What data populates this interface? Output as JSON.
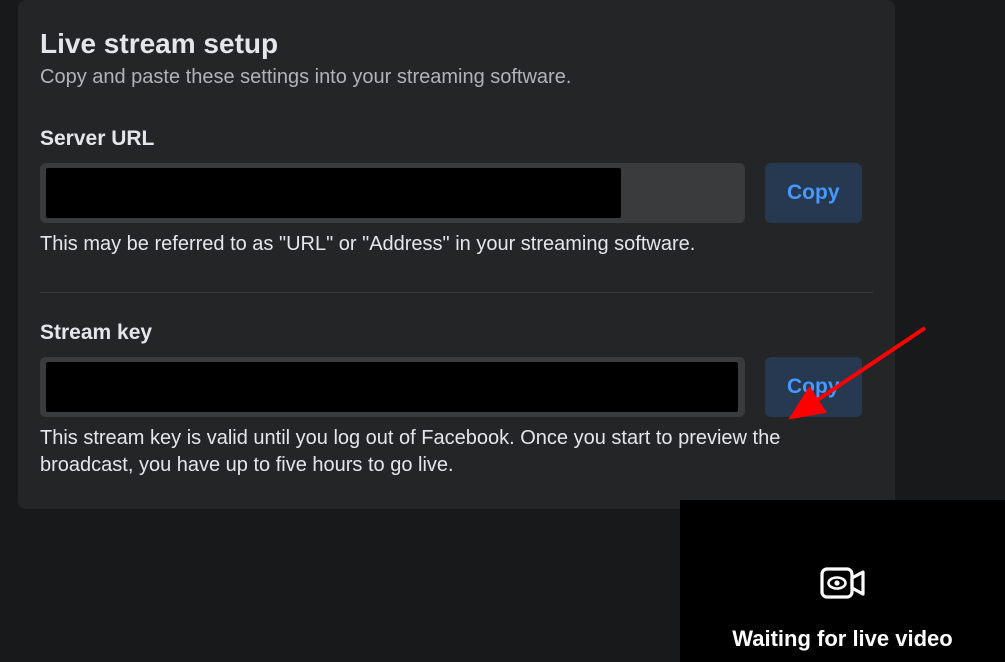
{
  "card": {
    "title": "Live stream setup",
    "subtitle": "Copy and paste these settings into your streaming software."
  },
  "server_url": {
    "label": "Server URL",
    "copy_label": "Copy",
    "help": "This may be referred to as \"URL\" or \"Address\" in your streaming software."
  },
  "stream_key": {
    "label": "Stream key",
    "copy_label": "Copy",
    "help": "This stream key is valid until you log out of Facebook. Once you start to preview the broadcast, you have up to five hours to go live."
  },
  "preview": {
    "status": "Waiting for live video"
  }
}
